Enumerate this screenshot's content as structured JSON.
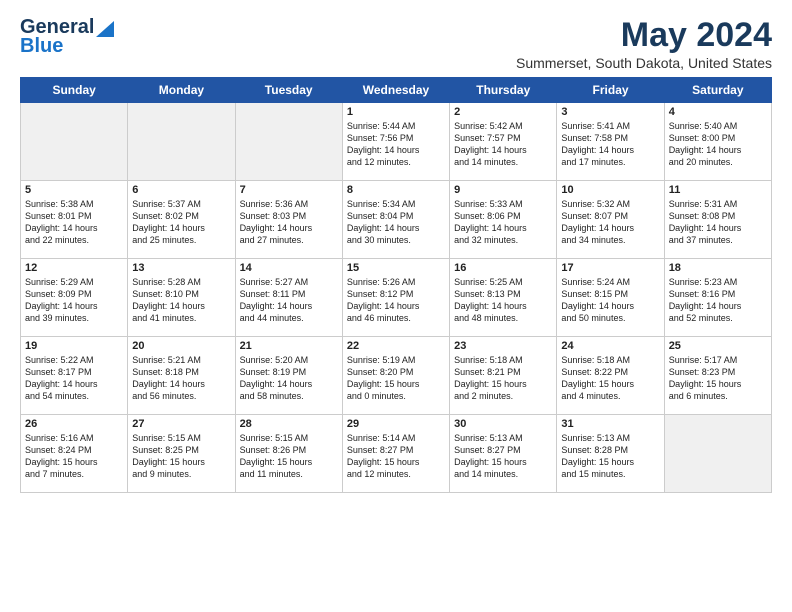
{
  "logo": {
    "line1": "General",
    "line2": "Blue"
  },
  "title": "May 2024",
  "subtitle": "Summerset, South Dakota, United States",
  "days_header": [
    "Sunday",
    "Monday",
    "Tuesday",
    "Wednesday",
    "Thursday",
    "Friday",
    "Saturday"
  ],
  "weeks": [
    [
      {
        "day": "",
        "info": "",
        "shaded": true
      },
      {
        "day": "",
        "info": "",
        "shaded": true
      },
      {
        "day": "",
        "info": "",
        "shaded": true
      },
      {
        "day": "1",
        "info": "Sunrise: 5:44 AM\nSunset: 7:56 PM\nDaylight: 14 hours\nand 12 minutes."
      },
      {
        "day": "2",
        "info": "Sunrise: 5:42 AM\nSunset: 7:57 PM\nDaylight: 14 hours\nand 14 minutes."
      },
      {
        "day": "3",
        "info": "Sunrise: 5:41 AM\nSunset: 7:58 PM\nDaylight: 14 hours\nand 17 minutes."
      },
      {
        "day": "4",
        "info": "Sunrise: 5:40 AM\nSunset: 8:00 PM\nDaylight: 14 hours\nand 20 minutes."
      }
    ],
    [
      {
        "day": "5",
        "info": "Sunrise: 5:38 AM\nSunset: 8:01 PM\nDaylight: 14 hours\nand 22 minutes."
      },
      {
        "day": "6",
        "info": "Sunrise: 5:37 AM\nSunset: 8:02 PM\nDaylight: 14 hours\nand 25 minutes."
      },
      {
        "day": "7",
        "info": "Sunrise: 5:36 AM\nSunset: 8:03 PM\nDaylight: 14 hours\nand 27 minutes."
      },
      {
        "day": "8",
        "info": "Sunrise: 5:34 AM\nSunset: 8:04 PM\nDaylight: 14 hours\nand 30 minutes."
      },
      {
        "day": "9",
        "info": "Sunrise: 5:33 AM\nSunset: 8:06 PM\nDaylight: 14 hours\nand 32 minutes."
      },
      {
        "day": "10",
        "info": "Sunrise: 5:32 AM\nSunset: 8:07 PM\nDaylight: 14 hours\nand 34 minutes."
      },
      {
        "day": "11",
        "info": "Sunrise: 5:31 AM\nSunset: 8:08 PM\nDaylight: 14 hours\nand 37 minutes."
      }
    ],
    [
      {
        "day": "12",
        "info": "Sunrise: 5:29 AM\nSunset: 8:09 PM\nDaylight: 14 hours\nand 39 minutes."
      },
      {
        "day": "13",
        "info": "Sunrise: 5:28 AM\nSunset: 8:10 PM\nDaylight: 14 hours\nand 41 minutes."
      },
      {
        "day": "14",
        "info": "Sunrise: 5:27 AM\nSunset: 8:11 PM\nDaylight: 14 hours\nand 44 minutes."
      },
      {
        "day": "15",
        "info": "Sunrise: 5:26 AM\nSunset: 8:12 PM\nDaylight: 14 hours\nand 46 minutes."
      },
      {
        "day": "16",
        "info": "Sunrise: 5:25 AM\nSunset: 8:13 PM\nDaylight: 14 hours\nand 48 minutes."
      },
      {
        "day": "17",
        "info": "Sunrise: 5:24 AM\nSunset: 8:15 PM\nDaylight: 14 hours\nand 50 minutes."
      },
      {
        "day": "18",
        "info": "Sunrise: 5:23 AM\nSunset: 8:16 PM\nDaylight: 14 hours\nand 52 minutes."
      }
    ],
    [
      {
        "day": "19",
        "info": "Sunrise: 5:22 AM\nSunset: 8:17 PM\nDaylight: 14 hours\nand 54 minutes."
      },
      {
        "day": "20",
        "info": "Sunrise: 5:21 AM\nSunset: 8:18 PM\nDaylight: 14 hours\nand 56 minutes."
      },
      {
        "day": "21",
        "info": "Sunrise: 5:20 AM\nSunset: 8:19 PM\nDaylight: 14 hours\nand 58 minutes."
      },
      {
        "day": "22",
        "info": "Sunrise: 5:19 AM\nSunset: 8:20 PM\nDaylight: 15 hours\nand 0 minutes."
      },
      {
        "day": "23",
        "info": "Sunrise: 5:18 AM\nSunset: 8:21 PM\nDaylight: 15 hours\nand 2 minutes."
      },
      {
        "day": "24",
        "info": "Sunrise: 5:18 AM\nSunset: 8:22 PM\nDaylight: 15 hours\nand 4 minutes."
      },
      {
        "day": "25",
        "info": "Sunrise: 5:17 AM\nSunset: 8:23 PM\nDaylight: 15 hours\nand 6 minutes."
      }
    ],
    [
      {
        "day": "26",
        "info": "Sunrise: 5:16 AM\nSunset: 8:24 PM\nDaylight: 15 hours\nand 7 minutes."
      },
      {
        "day": "27",
        "info": "Sunrise: 5:15 AM\nSunset: 8:25 PM\nDaylight: 15 hours\nand 9 minutes."
      },
      {
        "day": "28",
        "info": "Sunrise: 5:15 AM\nSunset: 8:26 PM\nDaylight: 15 hours\nand 11 minutes."
      },
      {
        "day": "29",
        "info": "Sunrise: 5:14 AM\nSunset: 8:27 PM\nDaylight: 15 hours\nand 12 minutes."
      },
      {
        "day": "30",
        "info": "Sunrise: 5:13 AM\nSunset: 8:27 PM\nDaylight: 15 hours\nand 14 minutes."
      },
      {
        "day": "31",
        "info": "Sunrise: 5:13 AM\nSunset: 8:28 PM\nDaylight: 15 hours\nand 15 minutes."
      },
      {
        "day": "",
        "info": "",
        "shaded": true
      }
    ]
  ]
}
